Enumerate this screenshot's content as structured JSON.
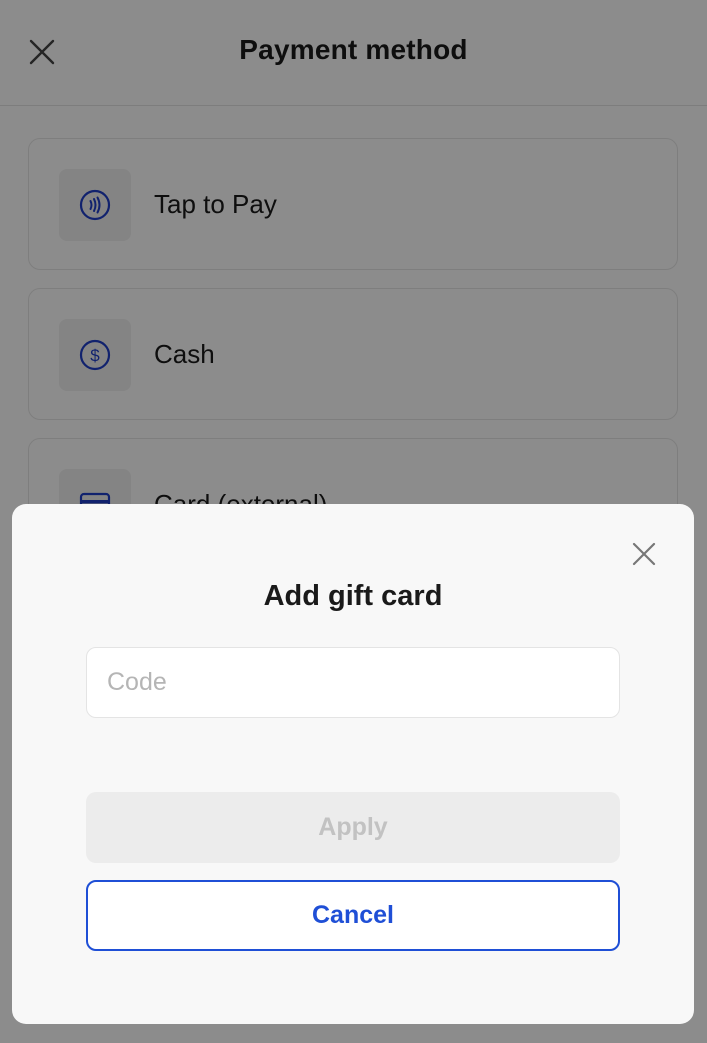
{
  "header": {
    "title": "Payment method",
    "close_icon": "close-icon"
  },
  "payment_options": [
    {
      "label": "Tap to Pay",
      "icon": "contactless-icon"
    },
    {
      "label": "Cash",
      "icon": "dollar-circle-icon"
    },
    {
      "label": "Card (external)",
      "icon": "credit-card-icon"
    }
  ],
  "dialog": {
    "title": "Add gift card",
    "code_placeholder": "Code",
    "code_value": "",
    "apply_label": "Apply",
    "cancel_label": "Cancel",
    "close_icon": "close-icon"
  },
  "colors": {
    "accent": "#1f4fd6",
    "icon_blue": "#1f3fc8",
    "scrim": "rgba(0,0,0,0.45)",
    "disabled_bg": "#ececec",
    "disabled_text": "#c2c2c2"
  }
}
